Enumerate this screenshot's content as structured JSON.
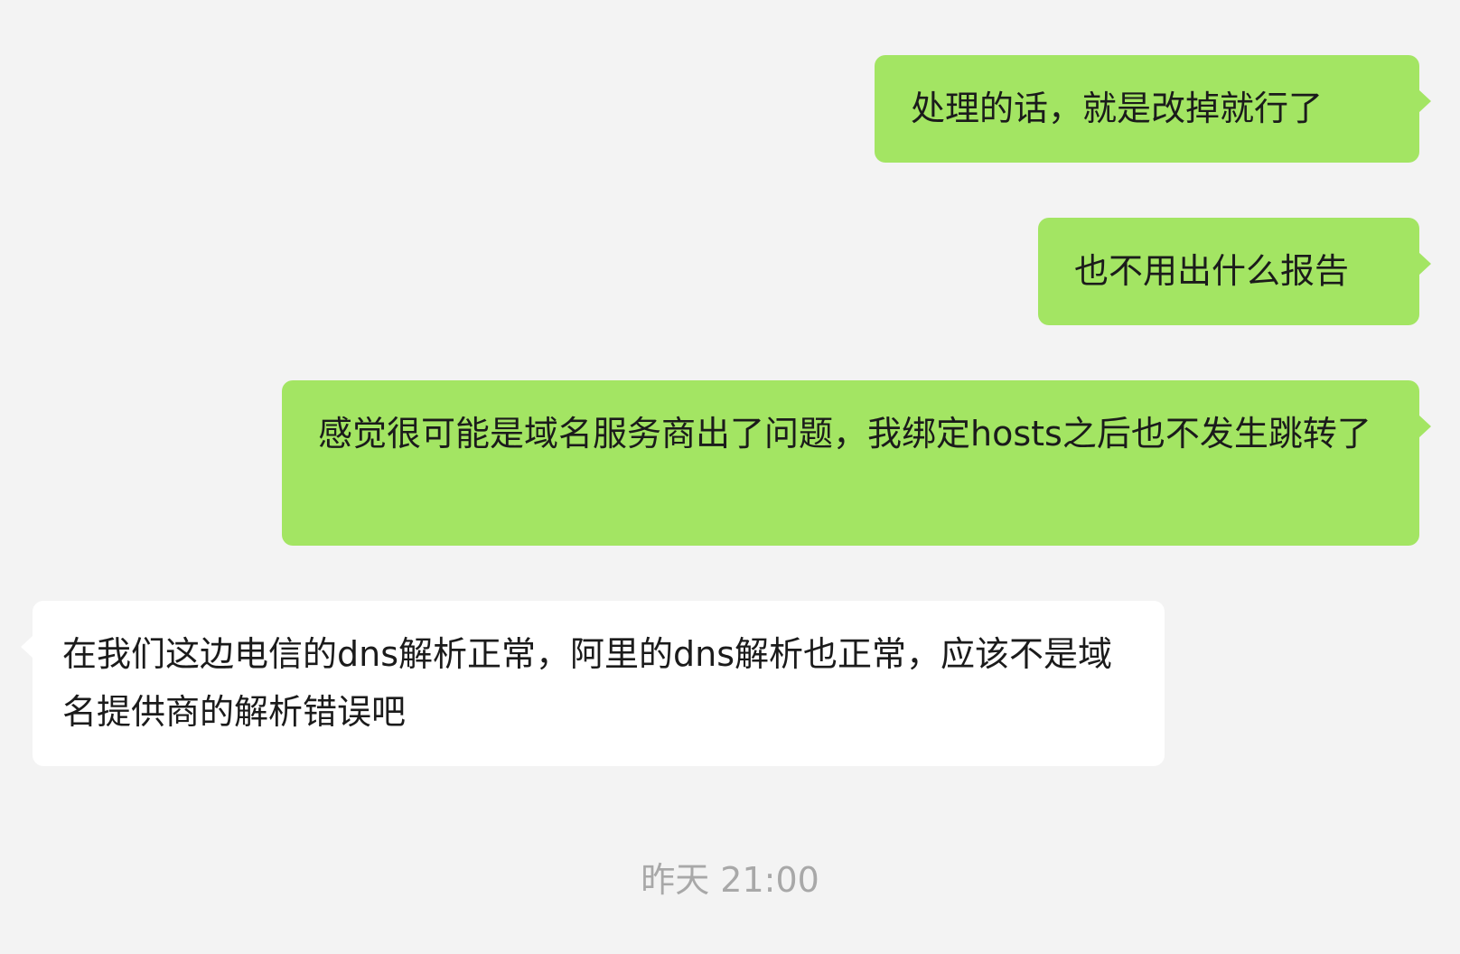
{
  "chat": {
    "messages": [
      {
        "direction": "outgoing",
        "text": "处理的话，就是改掉就行了"
      },
      {
        "direction": "outgoing",
        "text": "也不用出什么报告"
      },
      {
        "direction": "outgoing",
        "text": "感觉很可能是域名服务商出了问题，我绑定hosts之后也不发生跳转了"
      },
      {
        "direction": "incoming",
        "text": "在我们这边电信的dns解析正常，阿里的dns解析也正常，应该不是域名提供商的解析错误吧"
      }
    ],
    "timestamp": "昨天 21:00"
  },
  "colors": {
    "background": "#f3f3f3",
    "outgoing_bubble": "#a3e563",
    "incoming_bubble": "#ffffff",
    "text": "#1b1b1b",
    "timestamp": "#a8a8a8"
  }
}
